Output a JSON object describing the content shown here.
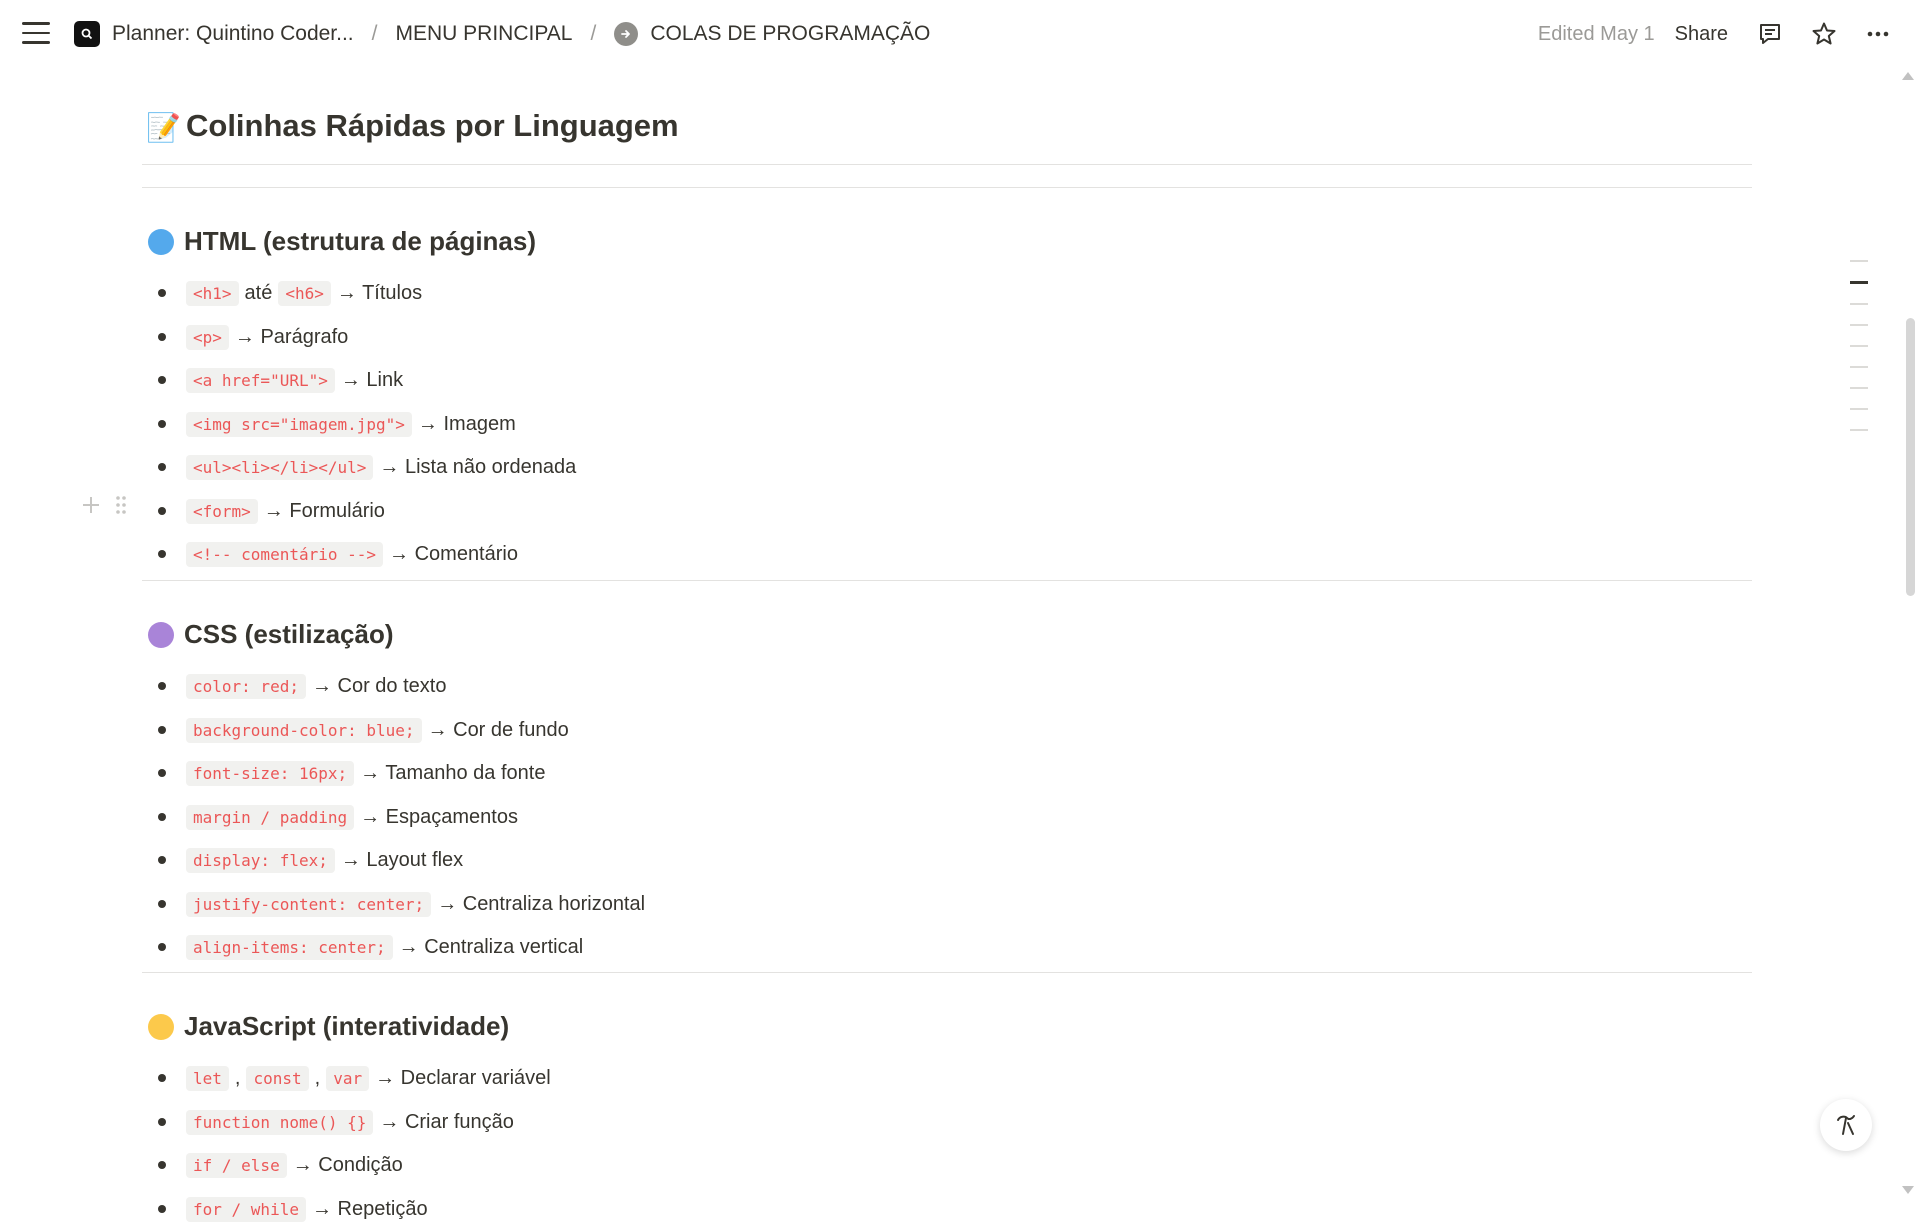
{
  "topbar": {
    "workspace_title": "Planner: Quintino Coder...",
    "separator": "/",
    "menu_crumb": "MENU PRINCIPAL",
    "current_crumb": "COLAS DE PROGRAMAÇÃO",
    "edited": "Edited May 1",
    "share": "Share"
  },
  "page": {
    "title_emoji": "📝",
    "title": "Colinhas Rápidas por Linguagem"
  },
  "sections": [
    {
      "heading": "HTML (estrutura de páginas)",
      "color": "#54a9ec",
      "items": [
        {
          "code": "<h1>",
          "mid": "até",
          "code2": "<h6>",
          "desc": "→ Títulos"
        },
        {
          "code": "<p>",
          "desc": "→ Parágrafo"
        },
        {
          "code": "<a href=\"URL\">",
          "desc": "→ Link"
        },
        {
          "code": "<img src=\"imagem.jpg\">",
          "desc": "→ Imagem"
        },
        {
          "code": "<ul><li></li></ul>",
          "desc": "→ Lista não ordenada"
        },
        {
          "code": "<form>",
          "desc": "→ Formulário"
        },
        {
          "code": "<!-- comentário -->",
          "desc": "→ Comentário"
        }
      ]
    },
    {
      "heading": "CSS (estilização)",
      "color": "#a984d8",
      "items": [
        {
          "code": "color: red;",
          "desc": "→ Cor do texto"
        },
        {
          "code": "background-color: blue;",
          "desc": "→ Cor de fundo"
        },
        {
          "code": "font-size: 16px;",
          "desc": "→ Tamanho da fonte"
        },
        {
          "code": "margin / padding",
          "desc": "→ Espaçamentos"
        },
        {
          "code": "display: flex;",
          "desc": "→ Layout flex"
        },
        {
          "code": "justify-content: center;",
          "desc": "→ Centraliza horizontal"
        },
        {
          "code": "align-items: center;",
          "desc": "→ Centraliza vertical"
        }
      ]
    },
    {
      "heading": "JavaScript (interatividade)",
      "color": "#fcc94b",
      "items": [
        {
          "code": "let",
          "mid": ",",
          "code2": "const",
          "mid2": ",",
          "code3": "var",
          "desc": "→ Declarar variável"
        },
        {
          "code": "function nome() {}",
          "desc": "→ Criar função"
        },
        {
          "code": "if / else",
          "desc": "→ Condição"
        },
        {
          "code": "for / while",
          "desc": "→ Repetição"
        }
      ]
    }
  ],
  "icons": {
    "menu": "hamburger-menu-icon",
    "workspace": "workspace-search-icon",
    "page_link": "arrow-right-circle-icon",
    "comments": "comment-icon",
    "favorite": "star-icon",
    "more": "more-horizontal-icon",
    "add_block": "plus-icon",
    "drag": "drag-handle-icon",
    "help": "notion-ai-icon"
  }
}
